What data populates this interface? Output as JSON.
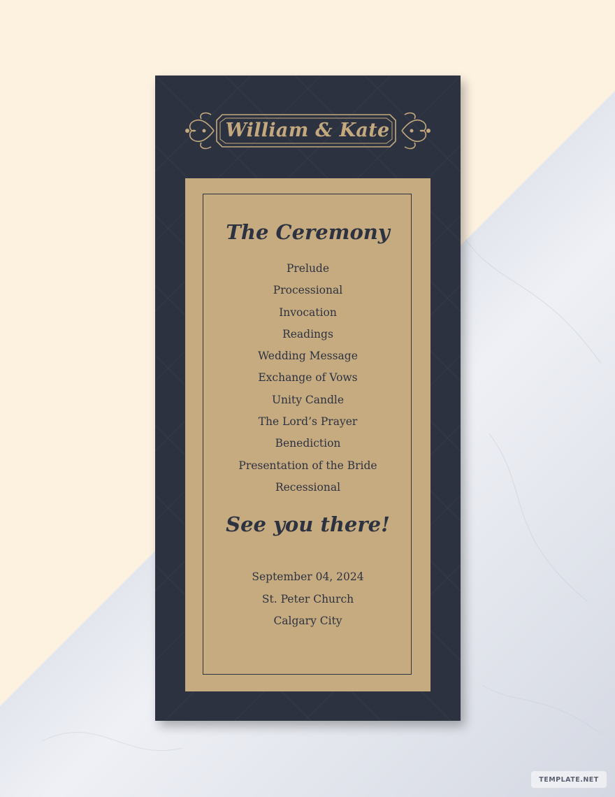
{
  "couple": "William & Kate",
  "ceremony": {
    "heading": "The Ceremony",
    "items": [
      "Prelude",
      "Processional",
      "Invocation",
      "Readings",
      "Wedding Message",
      "Exchange of Vows",
      "Unity Candle",
      "The Lord’s Prayer",
      "Benediction",
      "Presentation of the Bride",
      "Recessional"
    ]
  },
  "closing": {
    "heading": "See you there!",
    "date": "September 04, 2024",
    "venue": "St. Peter Church",
    "city": "Calgary City"
  },
  "watermark": "TEMPLATE.NET",
  "colors": {
    "card": "#2d3240",
    "panel": "#c6ab80",
    "gold": "#c4a97f",
    "background": "#fdf1e0"
  }
}
